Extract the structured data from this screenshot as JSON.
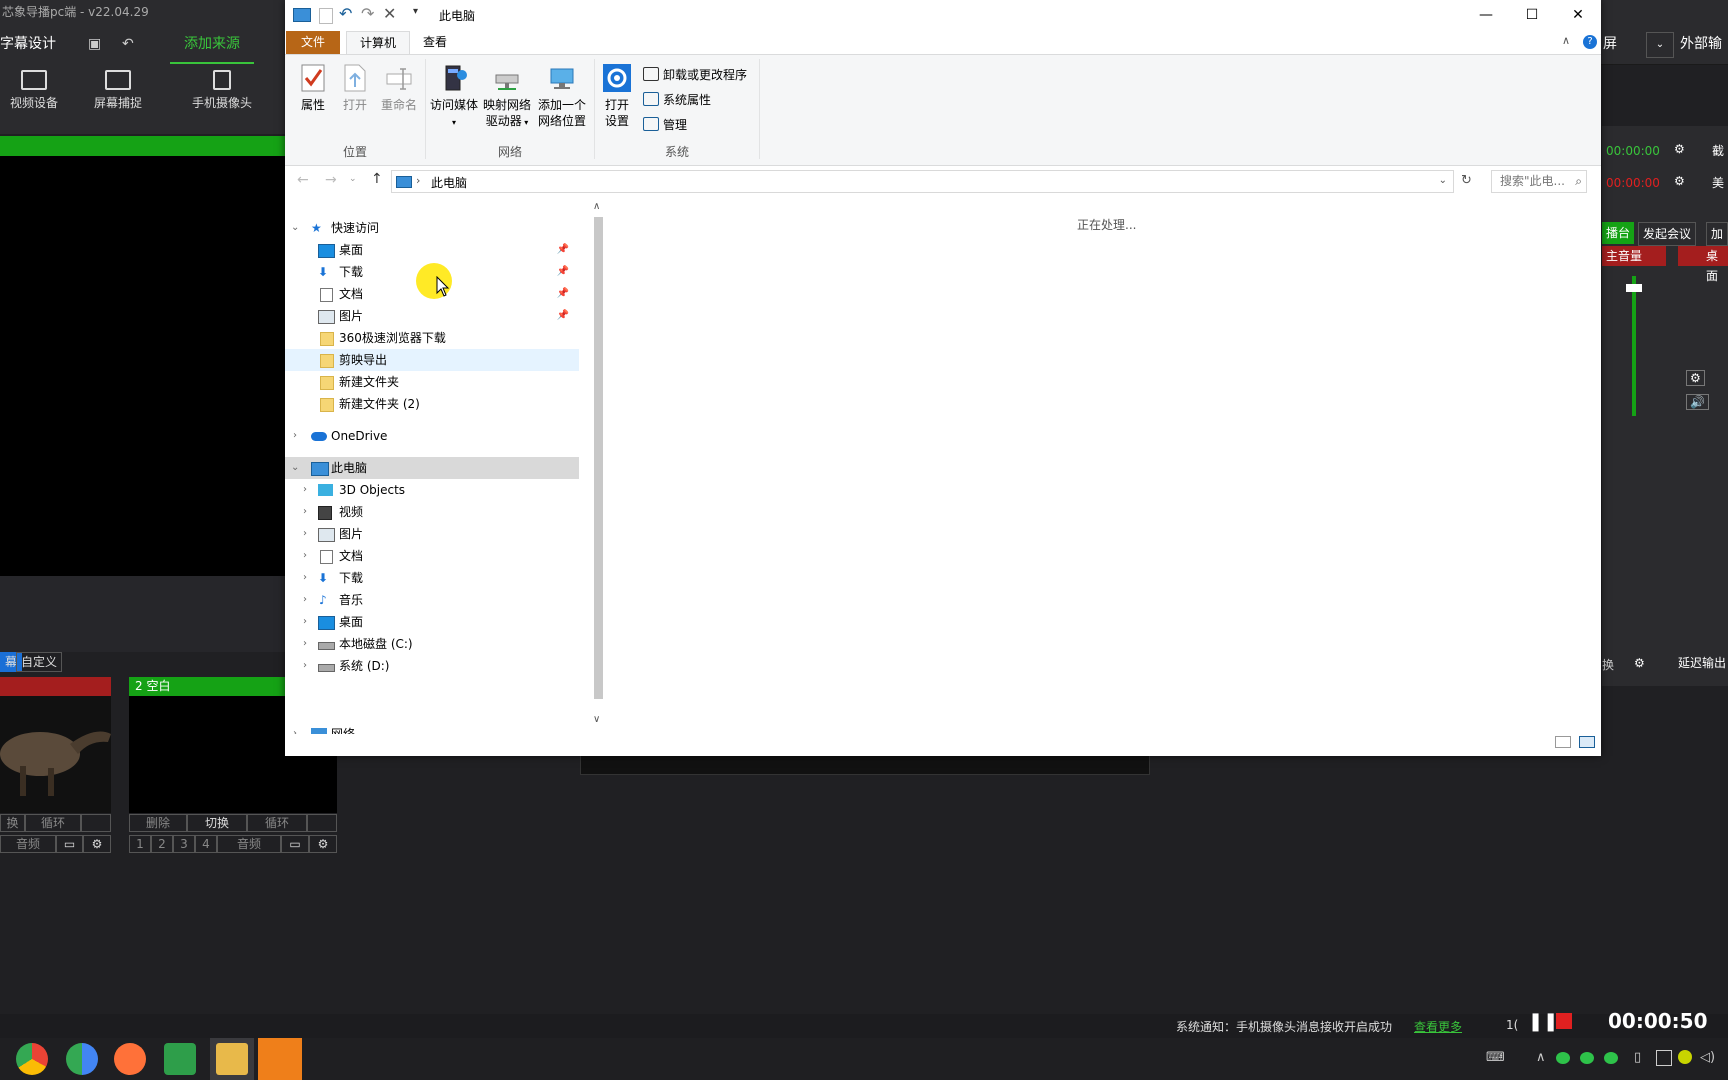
{
  "background_app": {
    "title": "芯象导播pc端 - v22.04.29",
    "toolbar": {
      "subtitle_design": "字幕设计",
      "add_source": "添加来源",
      "screen_label": "屏",
      "external_output": "外部输"
    },
    "sources": [
      {
        "label": "视频设备",
        "icon": "camera-icon"
      },
      {
        "label": "屏幕捕捉",
        "icon": "monitor-icon"
      },
      {
        "label": "手机摄像头",
        "icon": "phone-camera-icon"
      }
    ],
    "tabs": {
      "partial": "幕",
      "custom": "自定义"
    },
    "scene2_title": "2 空白",
    "scene1_controls": [
      "换",
      "循环",
      ""
    ],
    "scene1_audio": "音频",
    "scene2_controls": [
      "删除",
      "切换",
      "循环",
      ""
    ],
    "scene2_numbers": [
      "1",
      "2",
      "3",
      "4"
    ],
    "scene2_audio": "音频",
    "right_panel": {
      "timer1": "00:00:00",
      "timer2": "00:00:00",
      "crop": "截",
      "beauty": "美",
      "stage": "播台",
      "start_meeting": "发起会议",
      "join": "加入",
      "master_volume": "主音量",
      "desktop": "桌面",
      "delay_output": "延迟输出",
      "partial": "换"
    },
    "status_notice": "系统通知：手机摄像头消息接收开启成功",
    "view_more": "查看更多",
    "status_partial": "1("
  },
  "recording": {
    "timer": "00:00:50"
  },
  "explorer": {
    "title": "此电脑",
    "ribbon_tabs": [
      "文件",
      "计算机",
      "查看"
    ],
    "ribbon": {
      "location": {
        "label": "位置",
        "buttons": [
          {
            "label": "属性",
            "enabled": true
          },
          {
            "label": "打开",
            "enabled": false
          },
          {
            "label": "重命名",
            "enabled": false
          }
        ]
      },
      "network": {
        "label": "网络",
        "buttons": [
          {
            "label": "访问媒体"
          },
          {
            "label": "映射网络驱动器",
            "line1": "映射网络",
            "line2": "驱动器"
          },
          {
            "label": "添加一个网络位置",
            "line1": "添加一个",
            "line2": "网络位置"
          }
        ]
      },
      "system": {
        "label": "系统",
        "open_settings_line1": "打开",
        "open_settings_line2": "设置",
        "small_buttons": [
          "卸载或更改程序",
          "系统属性",
          "管理"
        ]
      }
    },
    "address": {
      "path": "此电脑",
      "search_placeholder": "搜索\"此电..."
    },
    "nav": {
      "quick_access": "快速访问",
      "quick_items": [
        {
          "label": "桌面",
          "pinned": true,
          "icon": "desktop-icon"
        },
        {
          "label": "下载",
          "pinned": true,
          "icon": "download-icon"
        },
        {
          "label": "文档",
          "pinned": true,
          "icon": "document-icon"
        },
        {
          "label": "图片",
          "pinned": true,
          "icon": "pictures-icon"
        },
        {
          "label": "360极速浏览器下载",
          "pinned": false,
          "icon": "folder-icon"
        },
        {
          "label": "剪映导出",
          "pinned": false,
          "icon": "folder-icon"
        },
        {
          "label": "新建文件夹",
          "pinned": false,
          "icon": "folder-icon"
        },
        {
          "label": "新建文件夹 (2)",
          "pinned": false,
          "icon": "folder-icon"
        }
      ],
      "onedrive": "OneDrive",
      "this_pc": "此电脑",
      "pc_items": [
        {
          "label": "3D Objects",
          "icon": "3d-objects-icon"
        },
        {
          "label": "视频",
          "icon": "video-icon"
        },
        {
          "label": "图片",
          "icon": "pictures-icon"
        },
        {
          "label": "文档",
          "icon": "document-icon"
        },
        {
          "label": "下载",
          "icon": "download-icon"
        },
        {
          "label": "音乐",
          "icon": "music-icon"
        },
        {
          "label": "桌面",
          "icon": "desktop-icon"
        },
        {
          "label": "本地磁盘 (C:)",
          "icon": "drive-icon"
        },
        {
          "label": "系统 (D:)",
          "icon": "drive-icon"
        }
      ],
      "network": "网络"
    },
    "content_status": "正在处理..."
  },
  "colors": {
    "accent_green": "#15a215",
    "file_tab": "#b76617",
    "record_red": "#e02020"
  }
}
